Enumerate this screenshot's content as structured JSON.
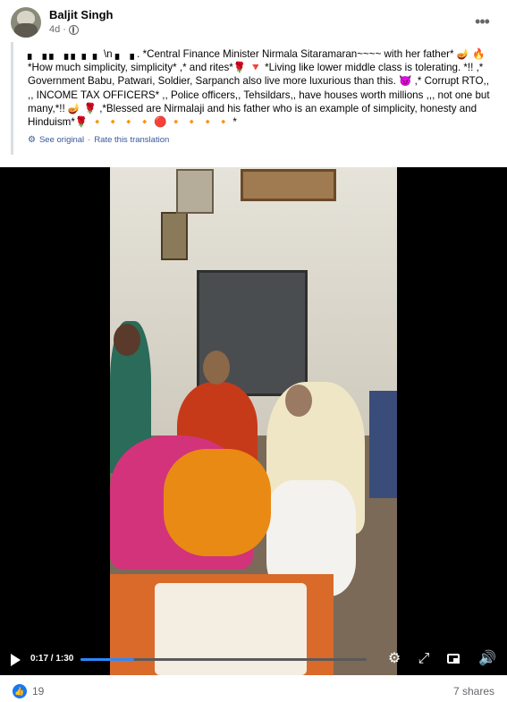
{
  "post": {
    "author": "Baljit Singh",
    "time": "4d ·",
    "text": "▖ ▗ ▖ ▗ ▖ ▖ ▖ \\n ▖ ▗ . *Central Finance Minister Nirmala Sitaramaran~~~~ with her father* 🪔 🔥 *How much simplicity, simplicity* ,* and rites*🌹 🔻 *Living like lower middle class is tolerating. *!! ,* Government Babu, Patwari, Soldier, Sarpanch also live more luxurious than this. 😈 ,* Corrupt RTO,, ,, INCOME TAX OFFICERS* ,, Police officers,, Tehsildars,, have houses worth millions ,,, not one but many,*!! 🪔 🌹 ,*Blessed are Nirmalaji and his father who is an example of simplicity, honesty and Hinduism*🌹 🔸 🔸 🔸 🔸 🔴 🔸 🔸 🔸 🔸 *",
    "see_original": "See original",
    "separator": "·",
    "rate_translation": "Rate this translation"
  },
  "video": {
    "time": "0:17 / 1:30",
    "progress": 0.189
  },
  "reactions": {
    "likes": "19",
    "shares": "7 shares"
  },
  "colors": {
    "accent": "#1877f2",
    "link": "#385898",
    "muted": "#65676b"
  },
  "icons": {
    "more": "more-options-icon",
    "globe": "globe-icon",
    "play": "play-icon",
    "settings": "gear-icon",
    "expand": "expand-icon",
    "pip": "picture-in-picture-icon",
    "fullscreen": "fullscreen-icon",
    "volume": "volume-icon",
    "like": "like-icon"
  }
}
